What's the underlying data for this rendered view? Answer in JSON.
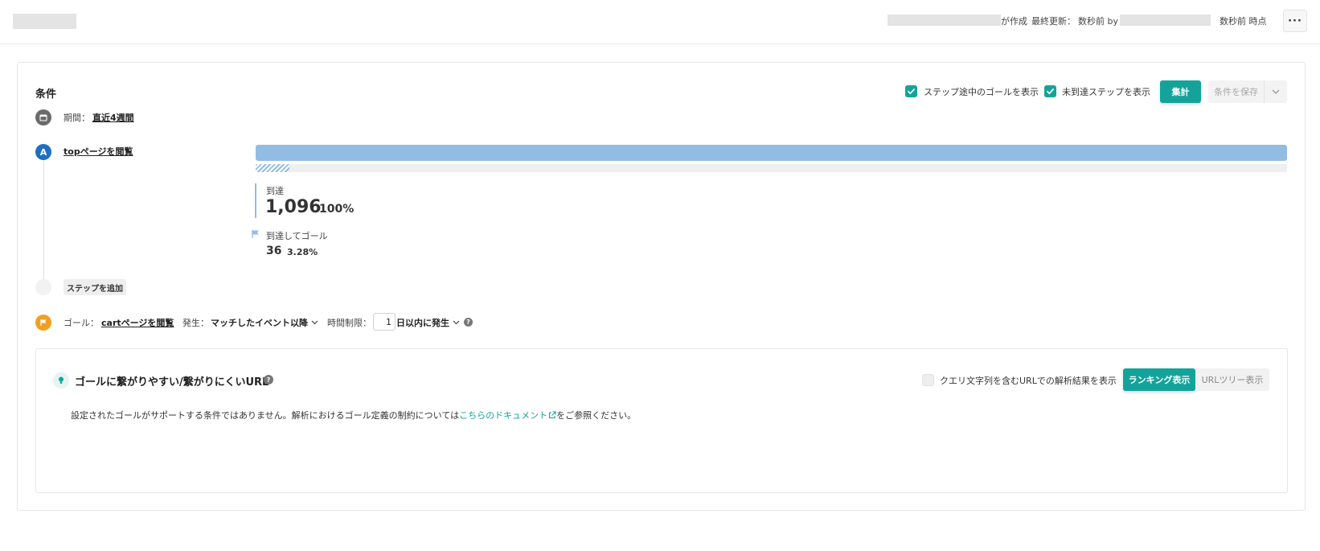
{
  "header": {
    "created_suffix": "が作成",
    "last_updated_label": "最終更新：",
    "last_updated_value": "数秒前 by",
    "as_of": "数秒前 時点",
    "more_label": "···"
  },
  "conditions": {
    "title": "条件",
    "show_goal_midstep_label": "ステップ途中のゴールを表示",
    "show_goal_midstep_checked": true,
    "show_unreached_label": "未到達ステップを表示",
    "show_unreached_checked": true,
    "aggregate_button": "集計",
    "save_button": "条件を保存",
    "period_label": "期間：",
    "period_value": "直近4週間"
  },
  "steps": [
    {
      "badge": "A",
      "name": "topページを閲覧",
      "reached_label": "到達",
      "reached_count": "1,096",
      "reached_pct": "100%",
      "reached_fraction": 1.0,
      "goal_label": "到達してゴール",
      "goal_count": "36",
      "goal_pct": "3.28%",
      "goal_fraction": 0.0328
    }
  ],
  "add_step_label": "ステップを追加",
  "goal": {
    "label": "ゴール：",
    "value": "cartページを閲覧",
    "occurrence_label": "発生：",
    "occurrence_value": "マッチしたイベント以降",
    "time_limit_label": "時間制限：",
    "time_limit_value": "1",
    "time_limit_unit": "日以内に発生"
  },
  "url_panel": {
    "title": "ゴールに繋がりやすい/繋がりにくいURL",
    "query_checkbox_label": "クエリ文字列を含むURLでの解析結果を表示",
    "query_checkbox_checked": false,
    "ranking_button": "ランキング表示",
    "tree_button": "URLツリー表示",
    "message_before": "設定されたゴールがサポートする条件ではありません。解析におけるゴール定義の制約については",
    "message_link": "こちらのドキュメント",
    "message_after": "をご参照ください。"
  },
  "colors": {
    "accent": "#14a39a",
    "bar": "#93bce3",
    "step_badge": "#1f6fbf",
    "goal_badge": "#f0a020",
    "period_badge": "#6b6b6b"
  }
}
